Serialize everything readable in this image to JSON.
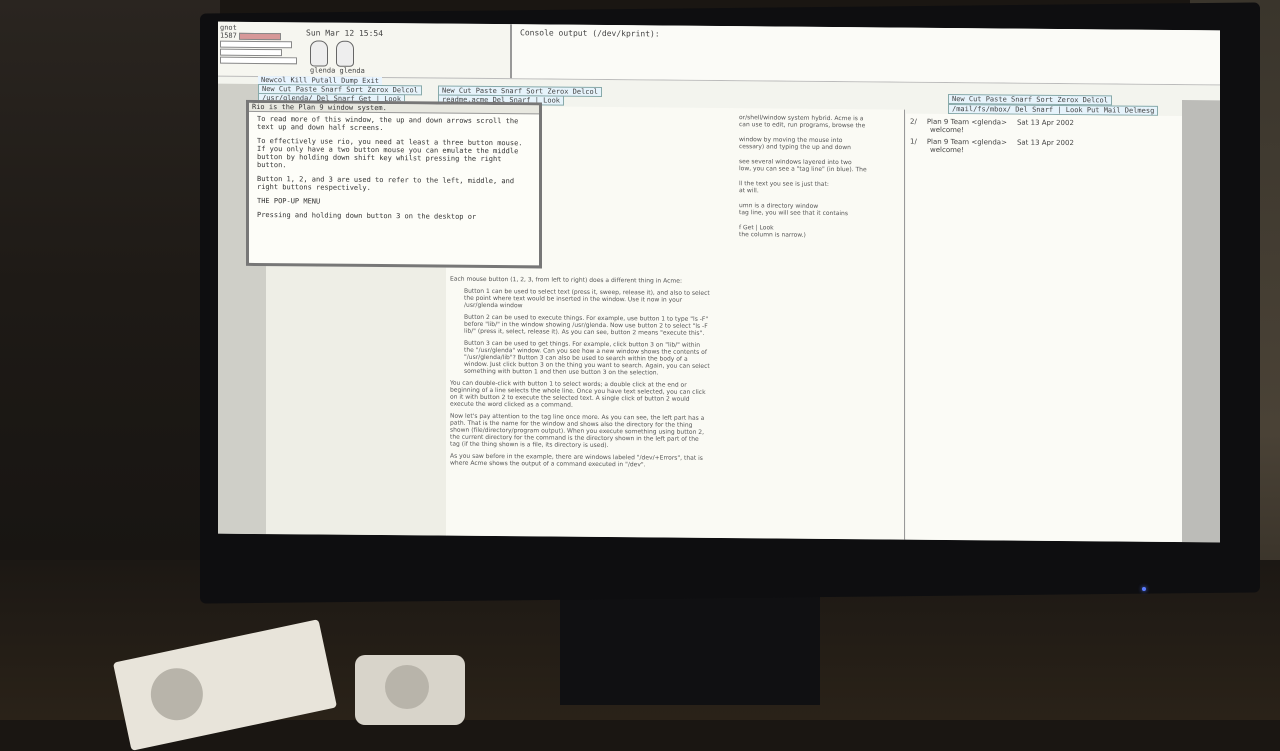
{
  "system": {
    "clock": "Sun Mar 12 15:54",
    "stats_labels": [
      "gnot",
      "1587"
    ],
    "faces_label": "glenda glenda"
  },
  "console": {
    "title": "Console output (/dev/kprint):"
  },
  "acme": {
    "menu": "Newcol Kill Putall Dump Exit",
    "col1_tag": "New Cut Paste Snarf Sort Zerox Delcol",
    "col2_tag": "New Cut Paste Snarf Sort Zerox Delcol",
    "col3_tag": "New Cut Paste Snarf Sort Zerox Delcol",
    "win1_tag": "/usr/glenda/ Del Snarf Get | Look",
    "win2_tag": "readme.acme Del Snarf | Look",
    "mail_tag": "/mail/fs/mbox/ Del Snarf | Look Put Mail Delmesg"
  },
  "popup": {
    "header": "Rio is the Plan 9 window system.",
    "paragraphs": [
      "To read more of this window, the up and down arrows scroll the text up and down half screens.",
      "To effectively use rio, you need at least a three button mouse. If you only have a two button mouse you can emulate the middle button by holding down shift key whilst pressing the right button.",
      "Button 1, 2, and 3 are used to refer to the left, middle, and right buttons respectively.",
      "THE POP-UP MENU",
      "Pressing and holding down button 3 on the desktop or"
    ]
  },
  "readme_visible": [
    "or/shell/window system hybrid. Acme is a",
    "can use to edit, run programs, browse the",
    "window by moving the mouse into",
    "cessary) and typing the up and down",
    "see several windows layered into two",
    "low, you can see a \"tag line\" (in blue). The",
    "ll the text you see is just that:",
    "at will.",
    "umn is a directory window",
    "tag line, you will see that it contains",
    "f Get | Look",
    "the column is narrow.)"
  ],
  "readme_lower": [
    {
      "text": "Each mouse button (1, 2, 3, from left to right) does a different thing in Acme:",
      "bullet": false
    },
    {
      "text": "Button 1 can be used to select text (press it, sweep, release it), and also to select the point where text would be inserted in the window. Use it now in your /usr/glenda window",
      "bullet": true
    },
    {
      "text": "Button 2 can be used to execute things. For example, use button 1 to type \"ls -F\" before \"lib/\" in the window showing /usr/glenda. Now use button 2 to select \"ls -F lib/\" (press it, select, release it). As you can see, button 2 means \"execute this\".",
      "bullet": true
    },
    {
      "text": "Button 3 can be used to get things. For example, click button 3 on \"lib/\" within the \"/usr/glenda\" window. Can you see how a new window shows the contents of \"/usr/glenda/lib\"? Button 3 can also be used to search within the body of a window. Just click button 3 on the thing you want to search. Again, you can select something with button 1 and then use button 3 on the selection.",
      "bullet": true
    },
    {
      "text": "You can double-click with button 1 to select words; a double click at the end or beginning of a line selects the whole line. Once you have text selected, you can click on it with button 2 to execute the selected text. A single click of button 2 would execute the word clicked as a command.",
      "bullet": false
    },
    {
      "text": "Now let's pay attention to the tag line once more. As you can see, the left part has a path. That is the name for the window and shows also the directory for the thing shown (file/directory/program output). When you execute something using button 2, the current directory for the command is the directory shown in the left part of the tag (if the thing shown is a file, its directory is used).",
      "bullet": false
    },
    {
      "text": "As you saw before in the example, there are windows labeled \"/dev/+Errors\", that is where Acme shows the output of a command executed in \"/dev\".",
      "bullet": false
    }
  ],
  "mail": [
    {
      "num": "2/",
      "from": "Plan 9 Team <glenda>",
      "date": "Sat 13 Apr 2002",
      "subject": "welcome!"
    },
    {
      "num": "1/",
      "from": "Plan 9 Team <glenda>",
      "date": "Sat 13 Apr 2002",
      "subject": "welcome!"
    }
  ],
  "colors": {
    "screen_bg": "#f3f4ee",
    "tag_bg": "#e6f3fb",
    "bezel": "#0e0e10",
    "led": "#5a7cff"
  }
}
